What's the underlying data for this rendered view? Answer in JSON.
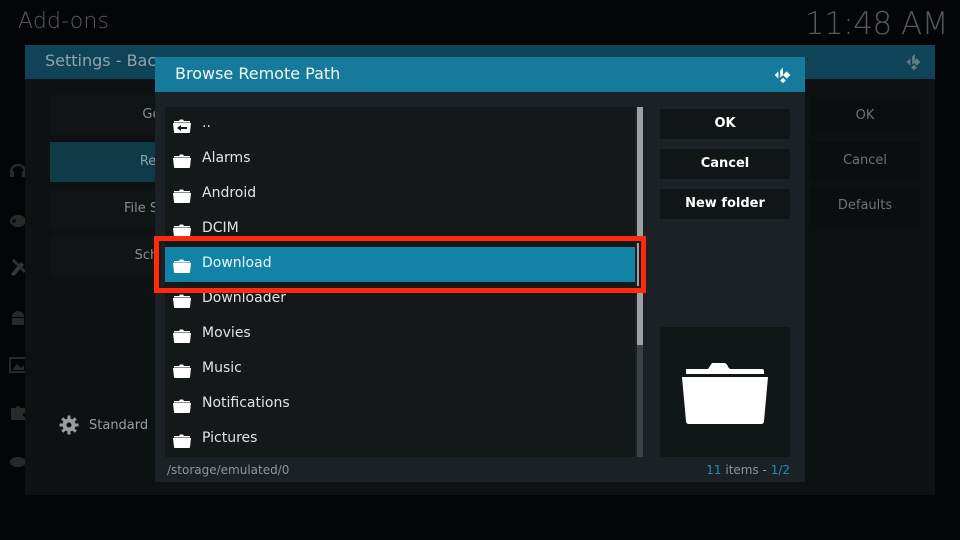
{
  "screen": {
    "section_title": "Add-ons",
    "clock": "11:48 AM"
  },
  "side_icons": [
    "headphones-icon",
    "gamepad-icon",
    "tools-icon",
    "android-icon",
    "picture-icon",
    "puzzle-icon",
    "gamepad-alt-icon"
  ],
  "settings_window": {
    "title": "Settings - Bac",
    "categories": [
      {
        "label": "Genera",
        "active": false
      },
      {
        "label": "Remote",
        "active": true
      },
      {
        "label": "File Select",
        "active": false
      },
      {
        "label": "Scheduli",
        "active": false
      }
    ],
    "level_label": "Standard",
    "buttons": [
      {
        "label": "OK"
      },
      {
        "label": "Cancel"
      },
      {
        "label": "Defaults"
      }
    ]
  },
  "dialog": {
    "title": "Browse Remote Path",
    "items": [
      {
        "label": "..",
        "icon": "folder-up-icon",
        "selected": false
      },
      {
        "label": "Alarms",
        "icon": "folder-icon",
        "selected": false
      },
      {
        "label": "Android",
        "icon": "folder-icon",
        "selected": false
      },
      {
        "label": "DCIM",
        "icon": "folder-icon",
        "selected": false
      },
      {
        "label": "Download",
        "icon": "folder-icon",
        "selected": true
      },
      {
        "label": "Downloader",
        "icon": "folder-icon",
        "selected": false
      },
      {
        "label": "Movies",
        "icon": "folder-icon",
        "selected": false
      },
      {
        "label": "Music",
        "icon": "folder-icon",
        "selected": false
      },
      {
        "label": "Notifications",
        "icon": "folder-icon",
        "selected": false
      },
      {
        "label": "Pictures",
        "icon": "folder-icon",
        "selected": false
      }
    ],
    "buttons": {
      "ok": "OK",
      "cancel": "Cancel",
      "new_folder": "New folder"
    },
    "current_path": "/storage/emulated/0",
    "item_count": "11",
    "items_word": " items - ",
    "page": "1/2",
    "scroll_fraction": 0.68
  },
  "colors": {
    "accent": "#167b9b",
    "selected": "#1283a7",
    "highlight_annotation": "#ff2a0e"
  }
}
